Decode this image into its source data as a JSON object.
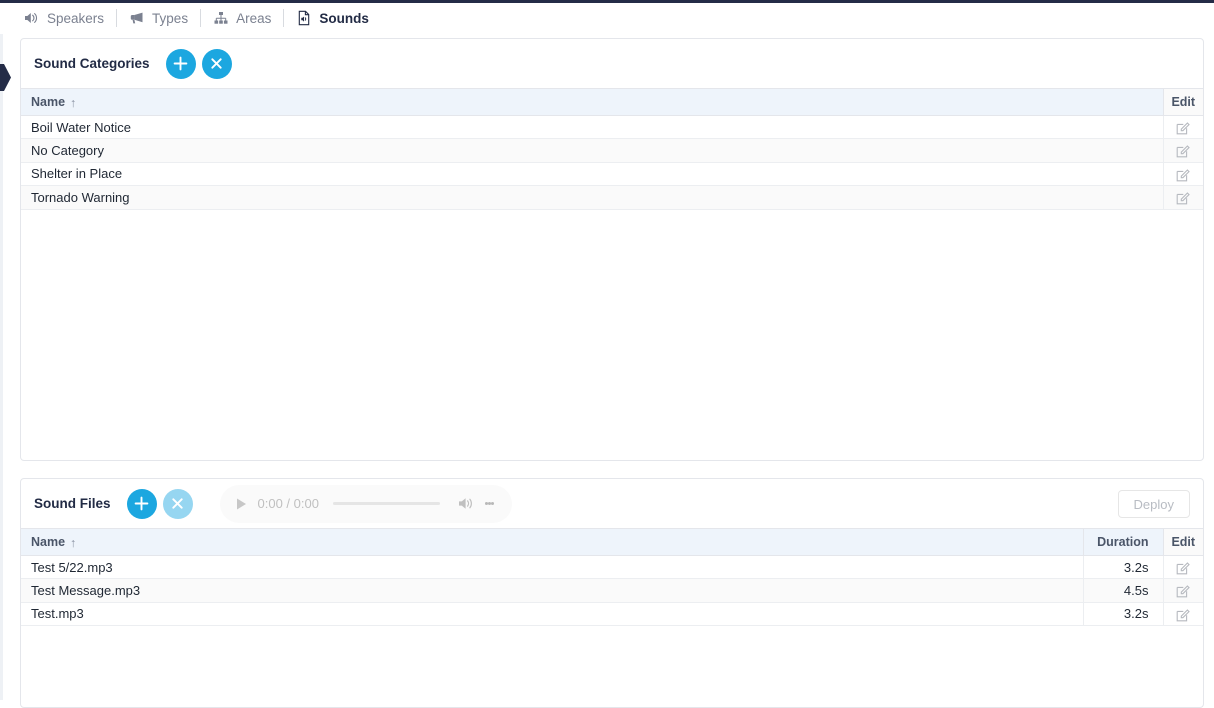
{
  "nav": {
    "tabs": [
      {
        "label": "Speakers",
        "icon": "volume-icon",
        "active": false
      },
      {
        "label": "Types",
        "icon": "megaphone-icon",
        "active": false
      },
      {
        "label": "Areas",
        "icon": "sitemap-icon",
        "active": false
      },
      {
        "label": "Sounds",
        "icon": "file-audio-icon",
        "active": true
      }
    ]
  },
  "colors": {
    "accent": "#1CA7E0",
    "accent_disabled": "#96d6f1",
    "header_bg": "#eef4fb",
    "dark": "#222b45"
  },
  "categories_card": {
    "title": "Sound Categories",
    "add_button": "+",
    "remove_button": "×",
    "columns": [
      "Name",
      "Edit"
    ],
    "sort_indicator": "↑",
    "rows": [
      {
        "name": "Boil Water Notice"
      },
      {
        "name": "No Category"
      },
      {
        "name": "Shelter in Place"
      },
      {
        "name": "Tornado Warning"
      }
    ]
  },
  "files_card": {
    "title": "Sound Files",
    "add_button": "+",
    "remove_button": "×",
    "deploy_label": "Deploy",
    "player": {
      "time": "0:00 / 0:00",
      "play_icon": "play-icon",
      "volume_icon": "volume-icon",
      "menu_icon": "kebab-menu-icon"
    },
    "columns": [
      "Name",
      "Duration",
      "Edit"
    ],
    "sort_indicator": "↑",
    "rows": [
      {
        "name": "Test 5/22.mp3",
        "duration": "3.2s"
      },
      {
        "name": "Test Message.mp3",
        "duration": "4.5s"
      },
      {
        "name": "Test.mp3",
        "duration": "3.2s"
      }
    ]
  }
}
